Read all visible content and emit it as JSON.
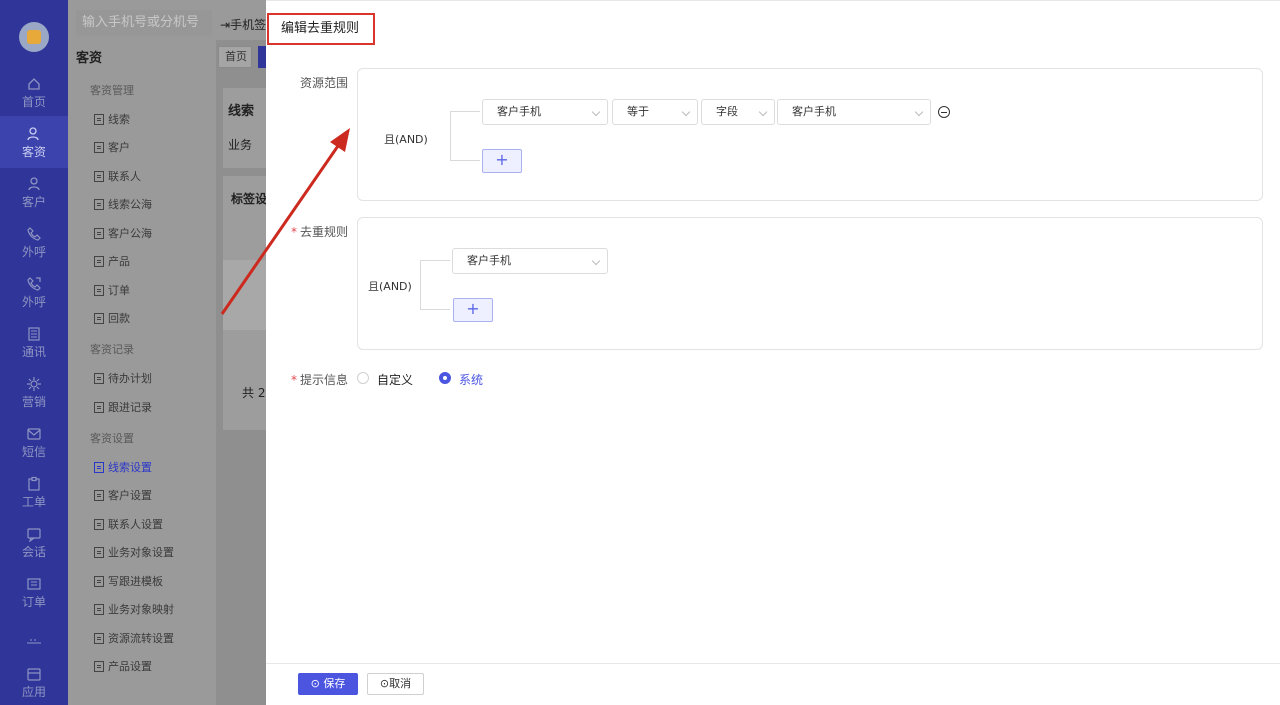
{
  "rail": {
    "items": [
      {
        "label": "首页",
        "icon": "home-icon"
      },
      {
        "label": "客资",
        "icon": "customer-resource-icon"
      },
      {
        "label": "客户",
        "icon": "user-icon"
      },
      {
        "label": "外呼",
        "icon": "phone-icon"
      },
      {
        "label": "外呼",
        "icon": "phone-out-icon"
      },
      {
        "label": "通讯",
        "icon": "contacts-icon"
      },
      {
        "label": "营销",
        "icon": "marketing-icon"
      },
      {
        "label": "短信",
        "icon": "sms-icon"
      },
      {
        "label": "工单",
        "icon": "ticket-icon"
      },
      {
        "label": "会话",
        "icon": "chat-icon"
      },
      {
        "label": "订单",
        "icon": "order-icon"
      },
      {
        "label": "",
        "icon": "more-icon"
      },
      {
        "label": "应用",
        "icon": "apps-icon"
      }
    ]
  },
  "subnav": {
    "search_placeholder": "输入手机号或分机号",
    "title": "客资",
    "groups": [
      {
        "label": "客资管理",
        "items": [
          "线索",
          "客户",
          "联系人",
          "线索公海",
          "客户公海",
          "产品",
          "订单",
          "回款"
        ]
      },
      {
        "label": "客资记录",
        "items": [
          "待办计划",
          "跟进记录"
        ]
      },
      {
        "label": "客资设置",
        "items": [
          "线索设置",
          "客户设置",
          "联系人设置",
          "业务对象设置",
          "写跟进模板",
          "业务对象映射",
          "资源流转设置",
          "产品设置"
        ]
      }
    ]
  },
  "background": {
    "topbar_text": "手机签",
    "tab_home": "首页",
    "label_1": "线索",
    "label_2": "业务",
    "label_3": "标签设",
    "label_4": "共 2"
  },
  "drawer": {
    "title": "编辑去重规则",
    "resource_scope": {
      "label": "资源范围",
      "logic": "且(AND)",
      "condition": {
        "field": "客户手机",
        "operator": "等于",
        "value_type": "字段",
        "value": "客户手机"
      }
    },
    "dedup_rule": {
      "label": "去重规则",
      "required": "*",
      "logic": "且(AND)",
      "field": "客户手机"
    },
    "prompt": {
      "label": "提示信息",
      "required": "*",
      "options": [
        "自定义",
        "系统"
      ],
      "selected": "系统"
    },
    "footer": {
      "save": "保存",
      "cancel": "取消"
    }
  },
  "colors": {
    "rail_bg": "#2f3599",
    "accent": "#4b55e0",
    "annotation": "#d9352c"
  }
}
